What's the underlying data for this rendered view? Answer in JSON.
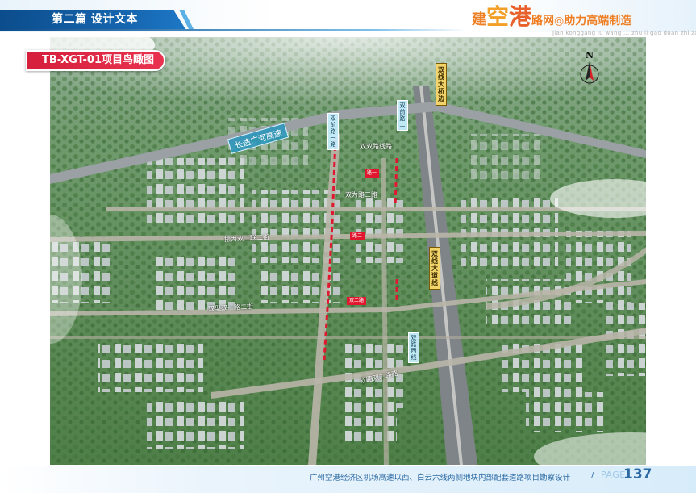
{
  "header": {
    "section_title": "第二篇  设计文本",
    "brand": {
      "char1": "建",
      "char2": "空",
      "char3": "港",
      "slogan_a": "路网",
      "slogan_b": "◎助力高端制造",
      "subtitle": "jian konggang lu wang ... zhu li gao duan zhi zao"
    }
  },
  "figure": {
    "label": "TB-XGT-01项目鸟瞰图",
    "north_letter": "N",
    "road_labels": {
      "expressway_blue": "长途广河高速",
      "vertical_yellow_1": "双线大桥边",
      "vertical_yellow_2": "双线大道线",
      "tag_1": "双前路一路",
      "tag_2": "双前路二",
      "tag_3": "双路西线",
      "road_west_a": "振为双二联二街",
      "road_west_b": "双型双一路二街",
      "road_mid_a": "双双路线路",
      "road_mid_b": "双为路二路",
      "road_bottom": "双路双二路路",
      "flag_1": "路一",
      "flag_2": "路二",
      "flag_3": "双二路"
    }
  },
  "footer": {
    "caption": "广州空港经济区机场高速以西、白云六线两侧地块内部配套道路项目勘察设计",
    "separator": "/",
    "page_word": "PAGE",
    "page_number": "137"
  },
  "colors": {
    "header_blue": "#1666b0",
    "brand_orange": "#ef7d22",
    "label_red": "#d61f3b",
    "footer_blue": "#2c6aa3"
  }
}
